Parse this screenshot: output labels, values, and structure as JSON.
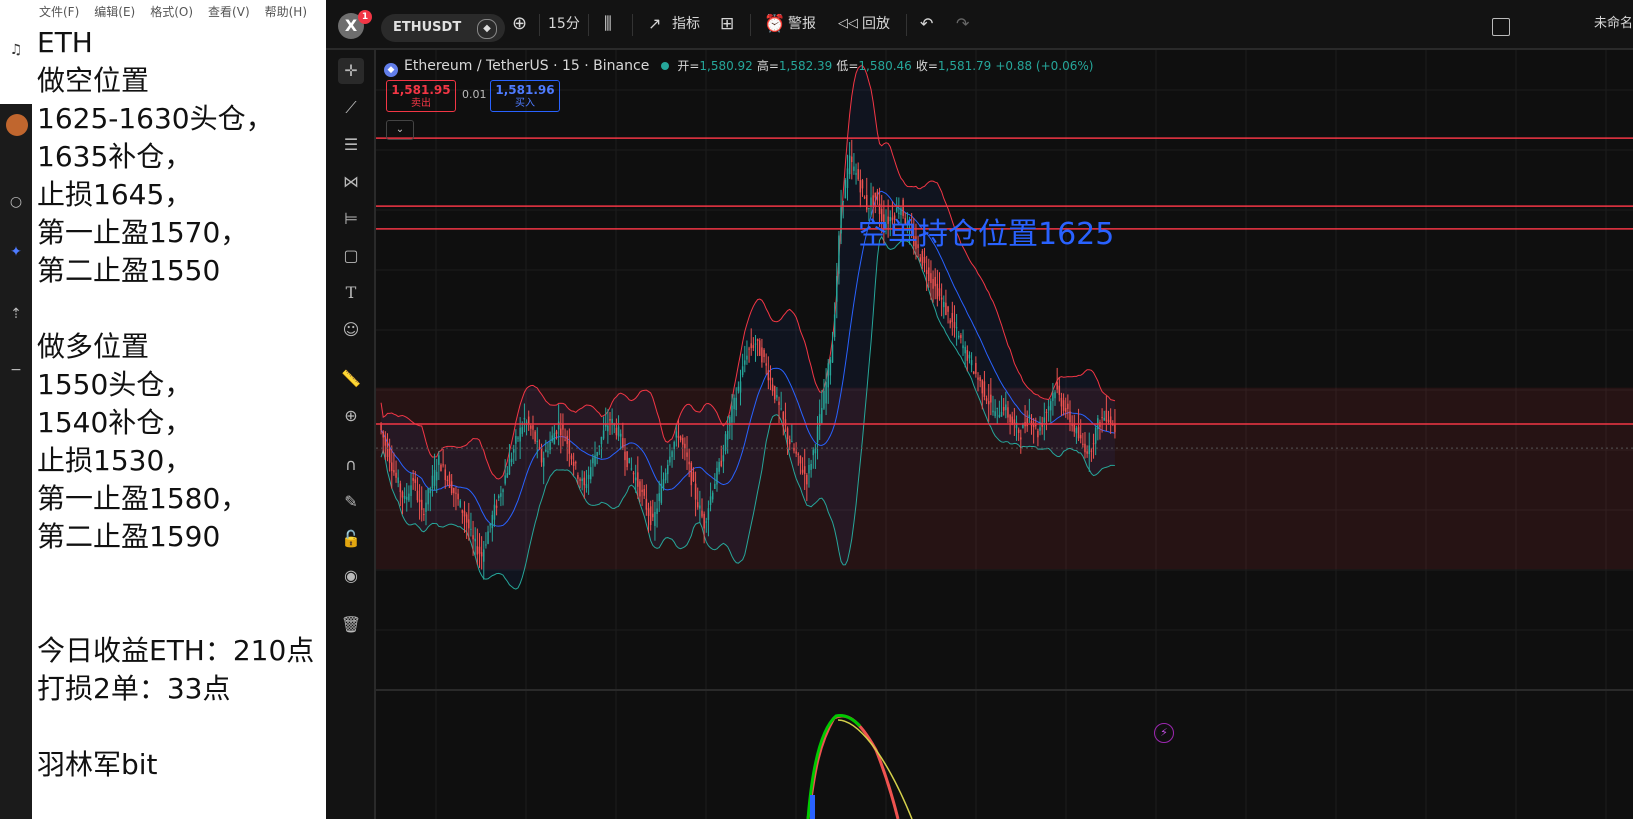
{
  "notepad": {
    "menu": [
      "文件(F)",
      "编辑(E)",
      "格式(O)",
      "查看(V)",
      "帮助(H)"
    ],
    "lines": [
      "ETH",
      "做空位置",
      "1625-1630头仓，",
      "1635补仓，",
      "止损1645，",
      "第一止盈1570，",
      "第二止盈1550",
      "",
      "做多位置",
      "1550头仓，",
      "1540补仓，",
      "止损1530，",
      "第一止盈1580，",
      "第二止盈1590",
      "",
      "",
      "今日收益ETH：210点",
      "打损2单：33点",
      "",
      "羽林军bit"
    ]
  },
  "topbar": {
    "logo": "X",
    "badge": "1",
    "symbol": "ETHUSDT",
    "interval": "15分",
    "indicators": "指标",
    "alert": "警报",
    "replay": "回放",
    "unnamed": "未命名"
  },
  "legend": {
    "name": "Ethereum / TetherUS · 15 · Binance",
    "open_label": "开=",
    "open": "1,580.92",
    "high_label": "高=",
    "high": "1,582.39",
    "low_label": "低=",
    "low": "1,580.46",
    "close_label": "收=",
    "close": "1,581.79",
    "change": "+0.88 (+0.06%)"
  },
  "trade": {
    "sell_price": "1,581.95",
    "sell_label": "卖出",
    "spread": "0.01",
    "buy_price": "1,581.96",
    "buy_label": "买入"
  },
  "annotation": "空单持仓位置1625",
  "colors": {
    "up": "#26a69a",
    "down": "#ef5350",
    "level_line": "#f23645",
    "annotation": "#2962ff",
    "bb_upper": "#f23645",
    "bb_lower": "#26a69a",
    "bb_basis": "#2962ff"
  },
  "chart_data": {
    "type": "candlestick",
    "symbol": "ETHUSDT",
    "interval": "15",
    "exchange": "Binance",
    "horizontal_levels": [
      1645,
      1630,
      1625,
      1582
    ],
    "zone": [
      1550,
      1590
    ],
    "bollinger": true,
    "price_path": [
      1582,
      1576,
      1570,
      1565,
      1570,
      1562,
      1568,
      1574,
      1570,
      1566,
      1562,
      1556,
      1553,
      1560,
      1566,
      1572,
      1578,
      1583,
      1580,
      1574,
      1578,
      1582,
      1578,
      1572,
      1568,
      1574,
      1579,
      1583,
      1580,
      1574,
      1570,
      1565,
      1560,
      1568,
      1576,
      1580,
      1574,
      1566,
      1560,
      1568,
      1574,
      1583,
      1590,
      1598,
      1600,
      1596,
      1590,
      1584,
      1578,
      1574,
      1570,
      1578,
      1588,
      1600,
      1630,
      1640,
      1636,
      1630,
      1632,
      1626,
      1628,
      1630,
      1624,
      1620,
      1616,
      1612,
      1608,
      1604,
      1600,
      1596,
      1592,
      1588,
      1584,
      1586,
      1582,
      1580,
      1584,
      1580,
      1585,
      1590,
      1586,
      1582,
      1578,
      1576,
      1582,
      1584,
      1581
    ]
  }
}
